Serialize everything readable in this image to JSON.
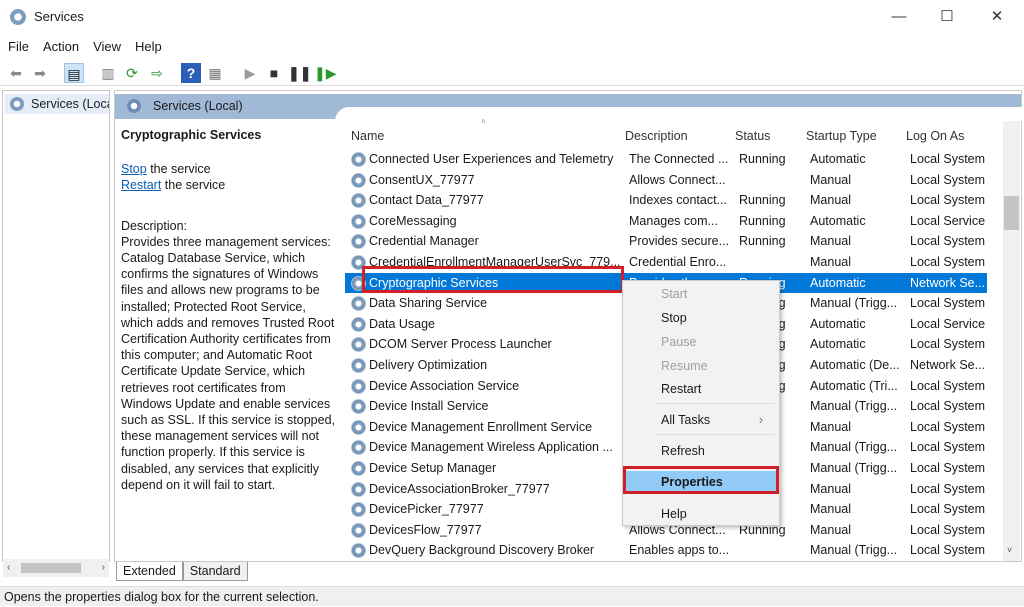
{
  "window": {
    "title": "Services",
    "icon": "gear-magnifier-icon"
  },
  "menubar": [
    "File",
    "Action",
    "View",
    "Help"
  ],
  "toolbar": [
    "back-icon",
    "forward-icon",
    "console-tree-icon",
    "properties-icon",
    "refresh-icon",
    "export-icon",
    "help-icon",
    "view-icon",
    "start-icon",
    "stop-icon",
    "pause-icon",
    "restart-icon"
  ],
  "tree": {
    "item": "Services (Local"
  },
  "header": {
    "title": "Services (Local)"
  },
  "details": {
    "service_name": "Cryptographic Services",
    "stop_link": "Stop",
    "stop_suffix": " the service",
    "restart_link": "Restart",
    "restart_suffix": " the service",
    "description_label": "Description:",
    "description": "Provides three management services: Catalog Database Service, which confirms the signatures of Windows files and allows new programs to be installed; Protected Root Service, which adds and removes Trusted Root Certification Authority certificates from this computer; and Automatic Root Certificate Update Service, which retrieves root certificates from Windows Update and enable services such as SSL. If this service is stopped, these management services will not function properly. If this service is disabled, any services that explicitly depend on it will fail to start."
  },
  "columns": [
    "Name",
    "Description",
    "Status",
    "Startup Type",
    "Log On As"
  ],
  "rows": [
    [
      "Connected User Experiences and Telemetry",
      "The Connected ...",
      "Running",
      "Automatic",
      "Local System"
    ],
    [
      "ConsentUX_77977",
      "Allows Connect...",
      "",
      "Manual",
      "Local System"
    ],
    [
      "Contact Data_77977",
      "Indexes contact...",
      "Running",
      "Manual",
      "Local System"
    ],
    [
      "CoreMessaging",
      "Manages com...",
      "Running",
      "Automatic",
      "Local Service"
    ],
    [
      "Credential Manager",
      "Provides secure...",
      "Running",
      "Manual",
      "Local System"
    ],
    [
      "CredentialEnrollmentManagerUserSvc_779...",
      "Credential Enro...",
      "",
      "Manual",
      "Local System"
    ],
    [
      "Cryptographic Services",
      "Provides thr...",
      "Running",
      "Automatic",
      "Network Se..."
    ],
    [
      "Data Sharing Service",
      "",
      "Running",
      "Manual (Trigg...",
      "Local System"
    ],
    [
      "Data Usage",
      "",
      "Running",
      "Automatic",
      "Local Service"
    ],
    [
      "DCOM Server Process Launcher",
      "",
      "Running",
      "Automatic",
      "Local System"
    ],
    [
      "Delivery Optimization",
      "",
      "Running",
      "Automatic (De...",
      "Network Se..."
    ],
    [
      "Device Association Service",
      "",
      "Running",
      "Automatic (Tri...",
      "Local System"
    ],
    [
      "Device Install Service",
      "",
      "",
      "Manual (Trigg...",
      "Local System"
    ],
    [
      "Device Management Enrollment Service",
      "",
      "",
      "Manual",
      "Local System"
    ],
    [
      "Device Management Wireless Application ...",
      "",
      "",
      "Manual (Trigg...",
      "Local System"
    ],
    [
      "Device Setup Manager",
      "",
      "",
      "Manual (Trigg...",
      "Local System"
    ],
    [
      "DeviceAssociationBroker_77977",
      "",
      "",
      "Manual",
      "Local System"
    ],
    [
      "DevicePicker_77977",
      "",
      "",
      "Manual",
      "Local System"
    ],
    [
      "DevicesFlow_77977",
      "Allows Connect...",
      "Running",
      "Manual",
      "Local System"
    ],
    [
      "DevQuery Background Discovery Broker",
      "Enables apps to...",
      "",
      "Manual (Trigg...",
      "Local System"
    ]
  ],
  "selected_row": 6,
  "context_menu": [
    {
      "label": "Start",
      "enabled": false
    },
    {
      "label": "Stop",
      "enabled": true
    },
    {
      "label": "Pause",
      "enabled": false
    },
    {
      "label": "Resume",
      "enabled": false
    },
    {
      "label": "Restart",
      "enabled": true
    },
    {
      "label": "All Tasks",
      "enabled": true,
      "submenu": "›"
    },
    {
      "label": "Refresh",
      "enabled": true
    },
    {
      "label": "Properties",
      "enabled": true,
      "bold": true,
      "highlighted": true
    },
    {
      "label": "Help",
      "enabled": true
    }
  ],
  "bottom_tabs": [
    "Extended",
    "Standard"
  ],
  "statusbar": "Opens the properties dialog box for the current selection.",
  "colors": {
    "selection": "#0078d7",
    "highlight_box": "#d0202a",
    "header": "#9fb9d6"
  }
}
